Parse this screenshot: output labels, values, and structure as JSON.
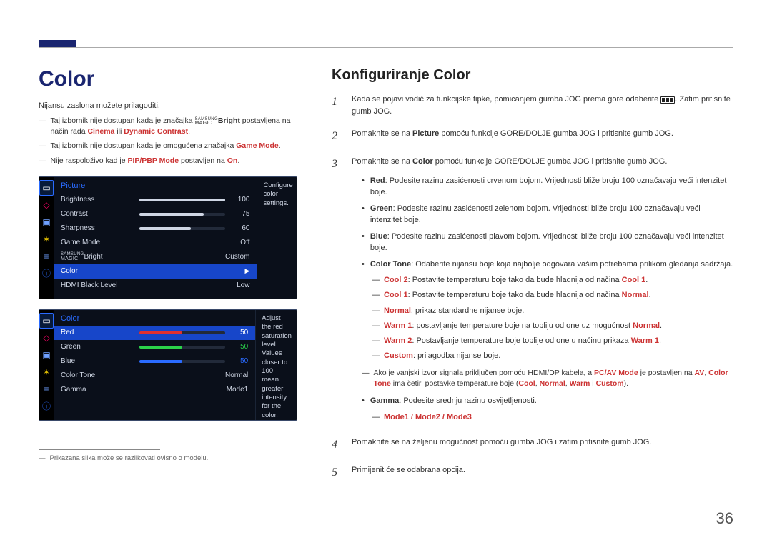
{
  "page_number": "36",
  "left": {
    "title": "Color",
    "intro": "Nijansu zaslona možete prilagoditi.",
    "notes": [
      {
        "pre": "Taj izbornik nije dostupan kada je značajka ",
        "magicbright": true,
        "mid": " postavljena na način rada ",
        "red1": "Cinema",
        "or": " ili ",
        "red2": "Dynamic Contrast",
        "post": "."
      },
      {
        "plain_pre": "Taj izbornik nije dostupan kada je omogućena značajka ",
        "red1": "Game Mode",
        "plain_post": "."
      },
      {
        "plain_pre": "Nije raspoloživo kad je ",
        "red1": "PIP/PBP Mode",
        "mid2": " postavljen na ",
        "red2": "On",
        "plain_post": "."
      }
    ],
    "osd1": {
      "title": "Picture",
      "help": "Configure color settings.",
      "rows": [
        {
          "label": "Brightness",
          "value": "100",
          "fill": 100
        },
        {
          "label": "Contrast",
          "value": "75",
          "fill": 75
        },
        {
          "label": "Sharpness",
          "value": "60",
          "fill": 60
        },
        {
          "label": "Game Mode",
          "value": "Off"
        },
        {
          "label_magic": "Bright",
          "value": "Custom"
        },
        {
          "label": "Color",
          "value": "",
          "selected": true,
          "arrow": "▶"
        },
        {
          "label": "HDMI Black Level",
          "value": "Low",
          "down_caret": true
        }
      ]
    },
    "osd2": {
      "title": "Color",
      "help": "Adjust the red saturation level. Values closer to 100 mean greater intensity for the color.",
      "rows": [
        {
          "label": "Red",
          "value": "50",
          "fill": 50,
          "fillclass": "red",
          "selected": true
        },
        {
          "label": "Green",
          "value": "50",
          "fill": 50,
          "fillclass": "green"
        },
        {
          "label": "Blue",
          "value": "50",
          "fill": 50,
          "fillclass": "blue"
        },
        {
          "label": "Color Tone",
          "value": "Normal"
        },
        {
          "label": "Gamma",
          "value": "Mode1"
        }
      ]
    },
    "footnote": "Prikazana slika može se razlikovati ovisno o modelu."
  },
  "right": {
    "title": "Konfiguriranje Color",
    "step1a": "Kada se pojavi vodič za funkcijske tipke, pomicanjem gumba JOG prema gore odaberite ",
    "step1b": ". Zatim pritisnite gumb JOG.",
    "step2_pre": "Pomaknite se na ",
    "step2_bold": "Picture",
    "step2_post": " pomoću funkcije GORE/DOLJE gumba JOG i pritisnite gumb JOG.",
    "step3_pre": "Pomaknite se na ",
    "step3_bold": "Color",
    "step3_post": " pomoću funkcije GORE/DOLJE gumba JOG i pritisnite gumb JOG.",
    "bullets": [
      {
        "k": "Red",
        "t": ": Podesite razinu zasićenosti crvenom bojom. Vrijednosti bliže broju 100 označavaju veći intenzitet boje."
      },
      {
        "k": "Green",
        "t": ": Podesite razinu zasićenosti zelenom bojom. Vrijednosti bliže broju 100 označavaju veći intenzitet boje."
      },
      {
        "k": "Blue",
        "t": ": Podesite razinu zasićenosti plavom bojom. Vrijednosti bliže broju 100 označavaju veći intenzitet boje."
      },
      {
        "k": "Color Tone",
        "t": ": Odaberite nijansu boje koja najbolje odgovara vašim potrebama prilikom gledanja sadržaja."
      }
    ],
    "subs": [
      {
        "k": "Cool 2",
        "t": ": Postavite temperaturu boje tako da bude hladnija od načina ",
        "r": "Cool 1",
        "post": "."
      },
      {
        "k": "Cool 1",
        "t": ": Postavite temperaturu boje tako da bude hladnija od načina ",
        "r": "Normal",
        "post": "."
      },
      {
        "k": "Normal",
        "t": ": prikaz standardne nijanse boje.",
        "r": "",
        "post": ""
      },
      {
        "k": "Warm 1",
        "t": ": postavljanje temperature boje na topliju od one uz mogućnost ",
        "r": "Normal",
        "post": "."
      },
      {
        "k": "Warm 2",
        "t": ": Postavljanje temperature boje toplije od one u načinu prikaza ",
        "r": "Warm 1",
        "post": "."
      },
      {
        "k": "Custom",
        "t": ": prilagodba nijanse boje.",
        "r": "",
        "post": ""
      }
    ],
    "dashnote": {
      "pre": "Ako je vanjski izvor signala priključen pomoću HDMI/DP kabela, a ",
      "r1": "PC/AV Mode",
      "mid1": " je postavljen na ",
      "r2": "AV",
      "mid2": ", ",
      "r3": "Color Tone",
      "post1": " ima četiri postavke temperature boje (",
      "r4": "Cool",
      "c1": ", ",
      "r5": "Normal",
      "c2": ", ",
      "r6": "Warm",
      "c3": " i ",
      "r7": "Custom",
      "post2": ")."
    },
    "gamma_k": "Gamma",
    "gamma_t": ": Podesite srednju razinu osvijetljenosti.",
    "gamma_sub": "Mode1 / Mode2 / Mode3",
    "step4": "Pomaknite se na željenu mogućnost pomoću gumba JOG i zatim pritisnite gumb JOG.",
    "step5": "Primijenit će se odabrana opcija."
  }
}
